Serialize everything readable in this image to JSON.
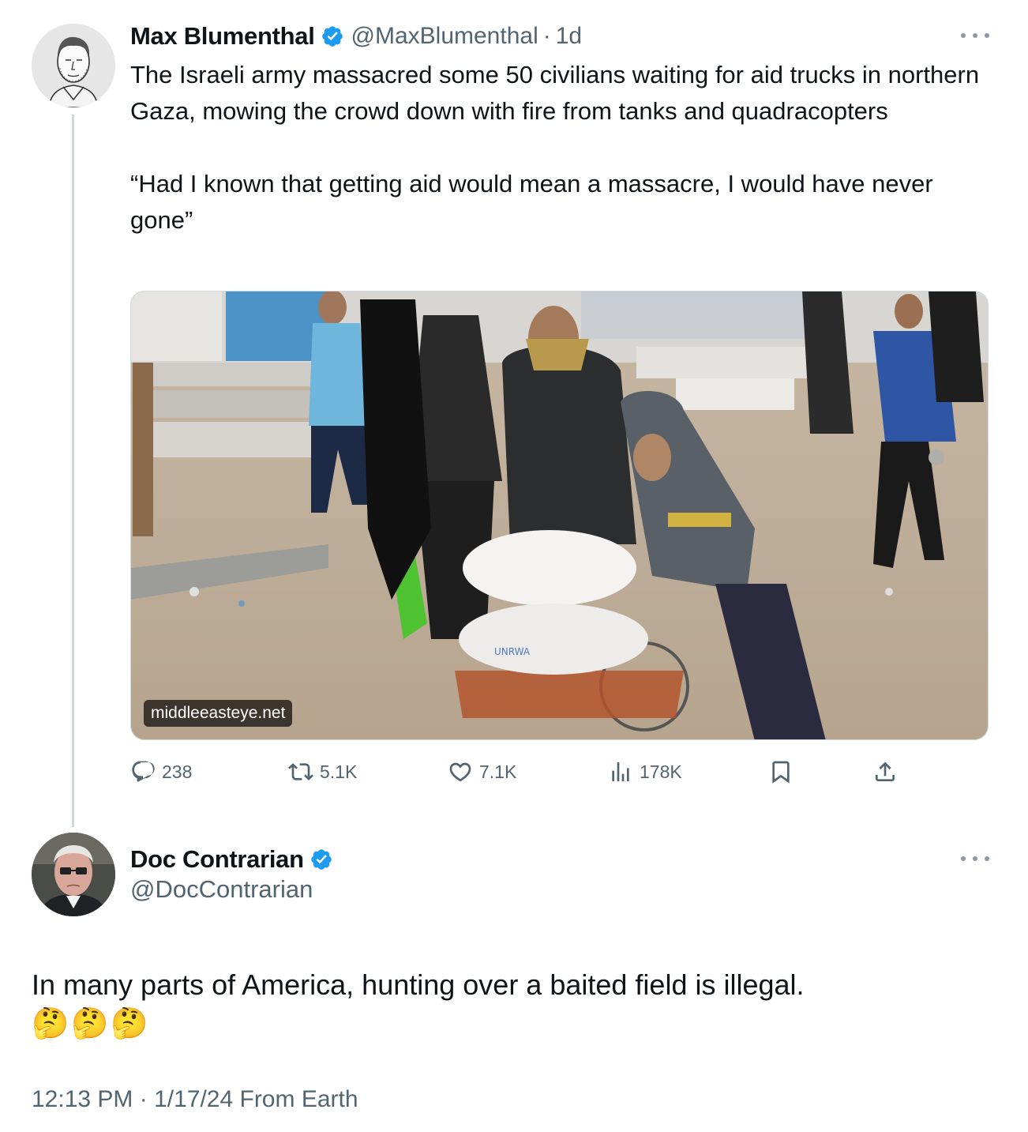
{
  "original_tweet": {
    "author_name": "Max Blumenthal",
    "handle": "@MaxBlumenthal",
    "separator": "·",
    "time": "1d",
    "text": "The Israeli army massacred some 50 civilians waiting for aid trucks in northern Gaza, mowing the crowd down with fire from tanks and quadracopters\n\n“Had I known that getting aid would mean a massacre, I would have never gone”",
    "media": {
      "domain_label": "middleeasteye.net"
    },
    "stats": {
      "replies": "238",
      "reposts": "5.1K",
      "likes": "7.1K",
      "views": "178K"
    },
    "icons": {
      "reply": "reply-icon",
      "repost": "repost-icon",
      "like": "heart-icon",
      "views": "views-chart-icon",
      "bookmark": "bookmark-icon",
      "share": "share-icon",
      "more": "more-options-icon",
      "verified": "verified-badge-icon"
    }
  },
  "reply_tweet": {
    "author_name": "Doc Contrarian",
    "handle": "@DocContrarian",
    "text": "In many parts of America, hunting over a baited field is illegal.",
    "emoji": [
      "🤔",
      "🤔",
      "🤔"
    ],
    "timestamp": "12:13 PM · 1/17/24 From Earth"
  },
  "colors": {
    "text_primary": "#0f1419",
    "text_secondary": "#536471",
    "verified_blue": "#1d9bf0",
    "thread_line": "#cfd9de"
  }
}
